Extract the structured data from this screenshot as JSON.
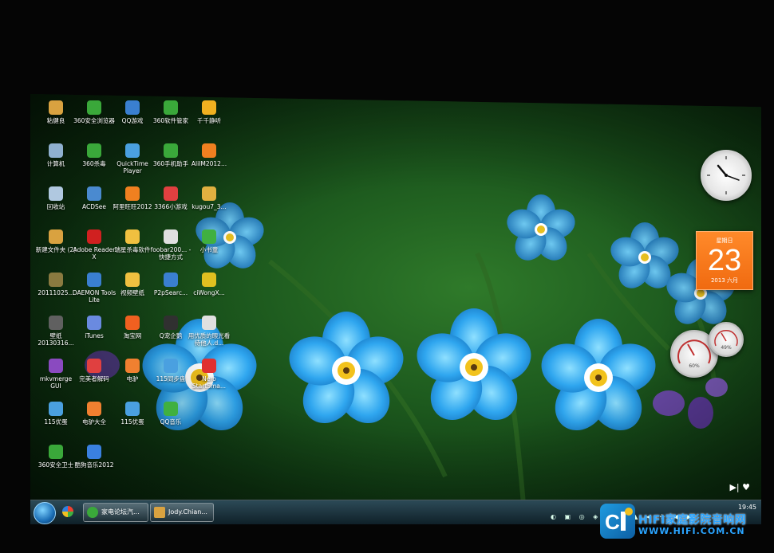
{
  "desktop": {
    "icons": [
      {
        "label": "粘健良",
        "color": "#d9a240"
      },
      {
        "label": "360安全浏览器",
        "color": "#3aa83a"
      },
      {
        "label": "QQ游戏",
        "color": "#3a7fd0"
      },
      {
        "label": "360软件管家",
        "color": "#3aa83a"
      },
      {
        "label": "千千静听",
        "color": "#f0b020"
      },
      {
        "label": "计算机",
        "color": "#8fb0d0"
      },
      {
        "label": "360杀毒",
        "color": "#3aa83a"
      },
      {
        "label": "QuickTime Player",
        "color": "#4aa0e0"
      },
      {
        "label": "360手机助手",
        "color": "#3aa83a"
      },
      {
        "label": "AliIM2012...",
        "color": "#f08020"
      },
      {
        "label": "回收站",
        "color": "#b0c8e0"
      },
      {
        "label": "ACDSee",
        "color": "#4a8ad0"
      },
      {
        "label": "阿里旺旺2012",
        "color": "#f08020"
      },
      {
        "label": "3366小游戏",
        "color": "#e04040"
      },
      {
        "label": "kugou7_3...",
        "color": "#e0b040"
      },
      {
        "label": "新建文件夹 (2)",
        "color": "#d9a240"
      },
      {
        "label": "Adobe Reader X",
        "color": "#d02020"
      },
      {
        "label": "瑞星杀毒软件",
        "color": "#f0c040"
      },
      {
        "label": "foobar200... - 快捷方式",
        "color": "#e0e0e0"
      },
      {
        "label": "小书童",
        "color": "#40b040"
      },
      {
        "label": "20111025...",
        "color": "#8a7a40"
      },
      {
        "label": "DAEMON Tools Lite",
        "color": "#3a7fd0"
      },
      {
        "label": "视频壁纸",
        "color": "#f0c040"
      },
      {
        "label": "P2pSearc...",
        "color": "#3a7fd0"
      },
      {
        "label": "ciWongX...",
        "color": "#e0c020"
      },
      {
        "label": "壁纸 20130316...",
        "color": "#606060"
      },
      {
        "label": "iTunes",
        "color": "#6a8ae0"
      },
      {
        "label": "淘宝网",
        "color": "#f06020"
      },
      {
        "label": "Q宠企鹅",
        "color": "#303030"
      },
      {
        "label": "用优质的眼光看待他人.d...",
        "color": "#e0e0e0"
      },
      {
        "label": "mkvmerge GUI",
        "color": "#8a4ac0"
      },
      {
        "label": "完美者解码",
        "color": "#e04040"
      },
      {
        "label": "电驴",
        "color": "#f08030"
      },
      {
        "label": "115同步盘",
        "color": "#4aa0e0"
      },
      {
        "label": "Nero StartSma...",
        "color": "#e03030"
      },
      {
        "label": "115优蛋",
        "color": "#4aa0e0"
      },
      {
        "label": "电驴大全",
        "color": "#f08030"
      },
      {
        "label": "115优蛋",
        "color": "#4aa0e0"
      },
      {
        "label": "QQ音乐",
        "color": "#40b040"
      },
      {
        "label": "360安全卫士",
        "color": "#3aa83a"
      },
      {
        "label": "酷狗音乐2012",
        "color": "#3a80e0"
      }
    ]
  },
  "gadgets": {
    "calendar": {
      "header": "星期日",
      "day": "23",
      "footer": "2013 六月"
    },
    "gauges": [
      {
        "value": "60%"
      },
      {
        "value": "49%"
      }
    ]
  },
  "taskbar": {
    "items": [
      {
        "label": "家电论坛汽...",
        "color": "#3aa83a"
      },
      {
        "label": "Jody.Chian...",
        "color": "#d9a240"
      }
    ],
    "time": "19:45"
  },
  "watermark": {
    "line1": "HIFI家庭影院音响网",
    "line2": "WWW.HIFI.COM.CN"
  }
}
